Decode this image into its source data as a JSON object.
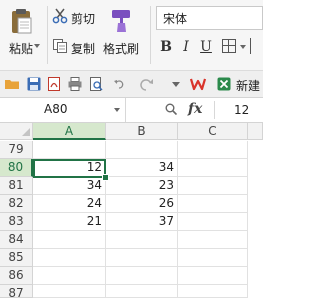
{
  "ribbon": {
    "paste_label": "粘贴",
    "cut_label": "剪切",
    "copy_label": "复制",
    "format_painter_label": "格式刷",
    "font_name": "宋体",
    "bold_label": "B",
    "italic_label": "I",
    "underline_label": "U"
  },
  "quick_access": {
    "icons": [
      "folder-icon",
      "save-icon",
      "pdf-export-icon",
      "print-icon",
      "print-preview-icon",
      "undo-icon",
      "redo-icon",
      "customize-icon",
      "wps-logo-icon",
      "new-sheet-icon"
    ],
    "new_label": "新建"
  },
  "formula_bar": {
    "name_box": "A80",
    "fx_label": "fx",
    "value": "12"
  },
  "grid": {
    "columns": [
      "A",
      "B",
      "C"
    ],
    "selected_column": "A",
    "rows": [
      {
        "row": "79",
        "A": "",
        "B": ""
      },
      {
        "row": "80",
        "A": "12",
        "B": "34"
      },
      {
        "row": "81",
        "A": "34",
        "B": "23"
      },
      {
        "row": "82",
        "A": "24",
        "B": "26"
      },
      {
        "row": "83",
        "A": "21",
        "B": "37"
      },
      {
        "row": "84",
        "A": "",
        "B": ""
      },
      {
        "row": "85",
        "A": "",
        "B": ""
      },
      {
        "row": "86",
        "A": "",
        "B": ""
      },
      {
        "row": "87",
        "A": "",
        "B": ""
      },
      {
        "row": "88",
        "A": "",
        "B": ""
      }
    ],
    "active_cell": "A80"
  },
  "colors": {
    "accent": "#217346",
    "selected_header_bg": "#d6e8cd",
    "ribbon_bg": "#f6f6f6",
    "wps_red": "#d9342b"
  }
}
